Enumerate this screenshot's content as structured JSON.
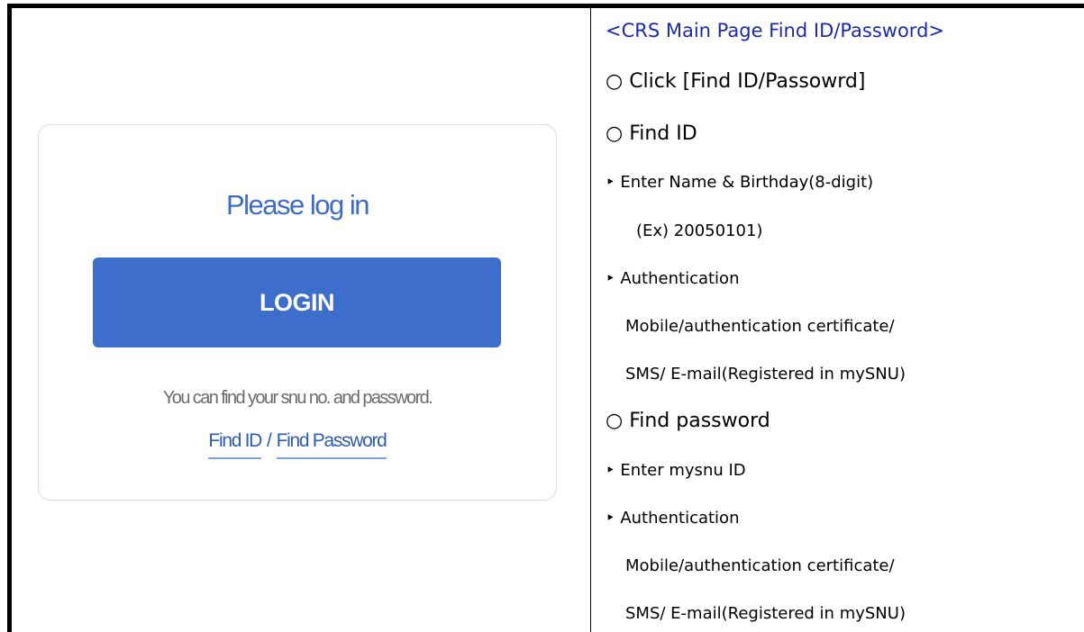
{
  "login": {
    "title": "Please log in",
    "button_label": "LOGIN",
    "hint": "You can find your snu no. and password.",
    "find_id_label": "Find ID",
    "separator": "/",
    "find_password_label": "Find Password"
  },
  "instructions": {
    "heading": "<CRS Main Page Find ID/Password>",
    "lines": [
      "○ Click [Find ID/Passowrd]",
      "○ Find ID",
      "‣  Enter Name & Birthday(8-digit)",
      "(Ex) 20050101)",
      "‣ Authentication",
      "Mobile/authentication certificate/",
      "SMS/ E-mail(Registered in mySNU)",
      "○ Find password",
      "‣ Enter mysnu ID",
      "‣ Authentication",
      "Mobile/authentication certificate/",
      "SMS/ E-mail(Registered in mySNU)"
    ]
  },
  "colors": {
    "accent": "#3e6ecc",
    "heading": "#1a2aa8",
    "link": "#2f5bb0"
  }
}
